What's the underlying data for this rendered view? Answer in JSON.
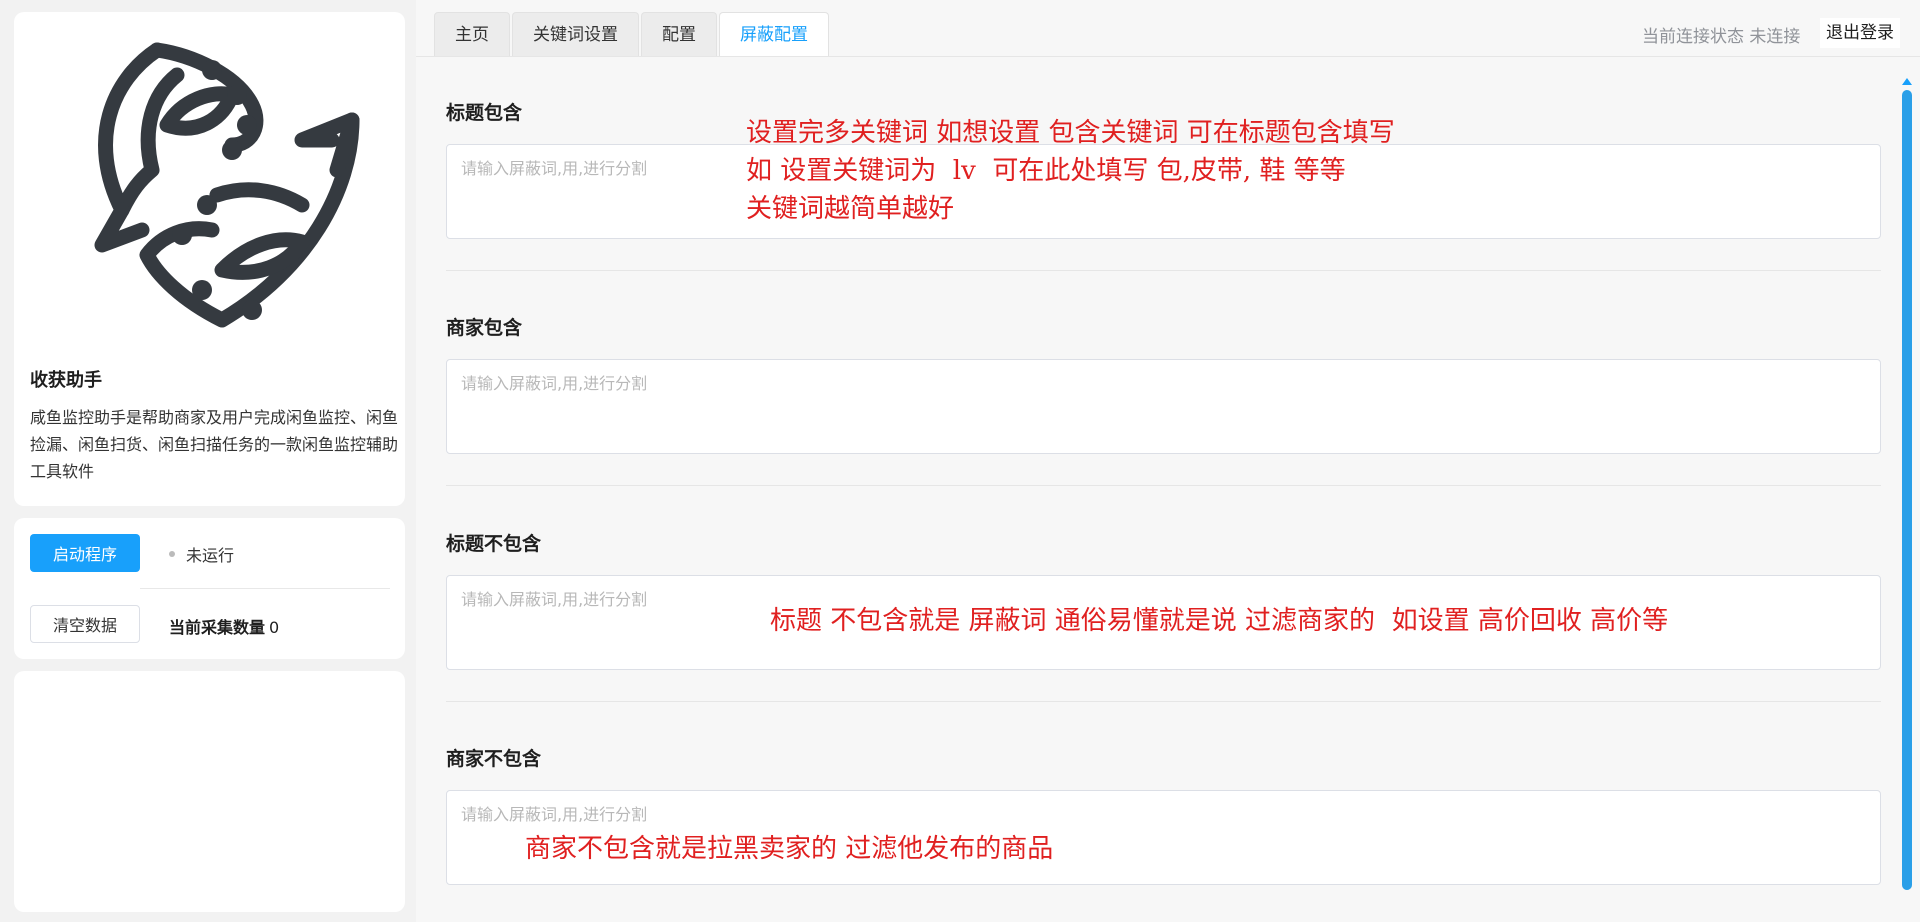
{
  "sidebar": {
    "app_name": "收获助手",
    "app_description": "咸鱼监控助手是帮助商家及用户完成闲鱼监控、闲鱼捡漏、闲鱼扫货、闲鱼扫描任务的一款闲鱼监控辅助工具软件",
    "start_button": "启动程序",
    "run_status": "未运行",
    "clear_button": "清空数据",
    "count_label": "当前采集数量",
    "count_value": "0"
  },
  "header": {
    "tabs": [
      {
        "label": "主页",
        "active": false
      },
      {
        "label": "关键词设置",
        "active": false
      },
      {
        "label": "配置",
        "active": false
      },
      {
        "label": "屏蔽配置",
        "active": true
      }
    ],
    "connection_status": "当前连接状态 未连接",
    "logout_button": "退出登录"
  },
  "sections": [
    {
      "label": "标题包含",
      "placeholder": "请输入屏蔽词,用,进行分割",
      "value": ""
    },
    {
      "label": "商家包含",
      "placeholder": "请输入屏蔽词,用,进行分割",
      "value": ""
    },
    {
      "label": "标题不包含",
      "placeholder": "请输入屏蔽词,用,进行分割",
      "value": ""
    },
    {
      "label": "商家不包含",
      "placeholder": "请输入屏蔽词,用,进行分割",
      "value": ""
    }
  ],
  "annotations": {
    "title_include_1": "设置完多关键词 如想设置 包含关键词 可在标题包含填写",
    "title_include_2": "如 设置关键词为  lv  可在此处填写 包,皮带, 鞋 等等",
    "title_include_3": "关键词越简单越好",
    "title_exclude": "标题 不包含就是 屏蔽词 通俗易懂就是说 过滤商家的  如设置 高价回收 高价等",
    "seller_exclude": "商家不包含就是拉黑卖家的 过滤他发布的商品"
  },
  "colors": {
    "accent": "#18a0fb",
    "annotation": "#e02020"
  }
}
